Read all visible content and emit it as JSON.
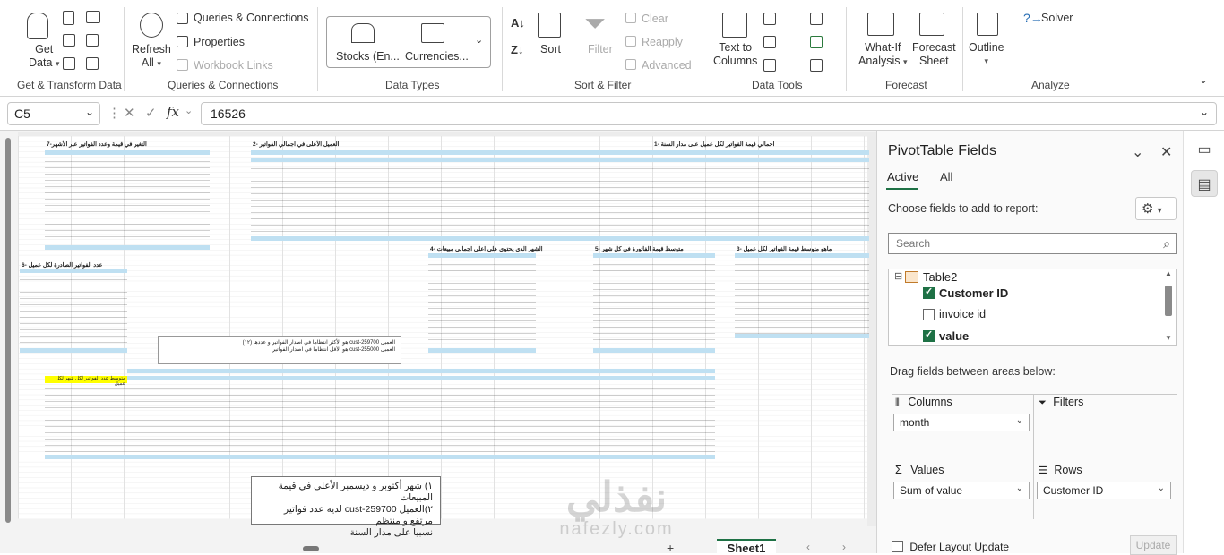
{
  "ribbon": {
    "get_data": "Get\nData",
    "get_data_l1": "Get",
    "get_data_l2": "Data",
    "queries_connections": "Queries & Connections",
    "properties": "Properties",
    "workbook_links": "Workbook Links",
    "refresh_l1": "Refresh",
    "refresh_l2": "All",
    "stocks": "Stocks (En...",
    "currencies": "Currencies...",
    "sort": "Sort",
    "filter": "Filter",
    "clear": "Clear",
    "reapply": "Reapply",
    "advanced": "Advanced",
    "text_to_columns_l1": "Text to",
    "text_to_columns_l2": "Columns",
    "what_if_l1": "What-If",
    "what_if_l2": "Analysis",
    "forecast_sheet_l1": "Forecast",
    "forecast_sheet_l2": "Sheet",
    "outline": "Outline",
    "solver": "Solver",
    "groups": {
      "get_transform": "Get & Transform Data",
      "queries": "Queries & Connections",
      "data_types": "Data Types",
      "sort_filter": "Sort & Filter",
      "data_tools": "Data Tools",
      "forecast": "Forecast",
      "analyze": "Analyze"
    }
  },
  "formula_bar": {
    "name_box": "C5",
    "value": "16526"
  },
  "sheet": {
    "tab": "Sheet1",
    "title_1": "اجمالي قيمة الفواتير لكل عميل على مدار السنة -1",
    "title_2": "العميل الأعلى في اجمالي الفواتير -2",
    "title_7": "التغير في قيمة وعدد الفواتير عبر الأشهر-7",
    "title_4": "الشهر الذي يحتوي على اعلى اجمالي مبيعات -4",
    "title_5": "متوسط قيمة الفاتورة في كل شهر -5",
    "title_3": "ماهو متوسط قيمة الفواتير لكل عميل -3",
    "title_6": "عدد الفواتير الصادرة لكل عميل -6",
    "yellow_note": "متوسط عدد الفواتير لكل شهر لكل عميل",
    "note_small_1": "العميل cust-259700 هو الأكثر انتظاما في اصدار الفواتير و عددها (١٢)",
    "note_small_2": "العميل cust-255000 هو الأقل انتظاما في اصدار الفواتير",
    "note_big_1": "١) شهر أكتوبر و ديسمبر الأعلى في قيمة المبيعات",
    "note_big_2": "٢)العميل cust-259700 لديه عدد فواتير مرتفع و منتظم",
    "note_big_3": "نسبيا على مدار السنة",
    "watermark_big": "نفذلي",
    "watermark_small": "nafezly.com"
  },
  "pivot": {
    "title": "PivotTable Fields",
    "tab_active": "Active",
    "tab_all": "All",
    "choose_label": "Choose fields to add to report:",
    "search_placeholder": "Search",
    "table_name": "Table2",
    "fields": [
      {
        "name": "Customer ID",
        "checked": true
      },
      {
        "name": "invoice id",
        "checked": false
      },
      {
        "name": "value",
        "checked": true
      }
    ],
    "drag_label": "Drag fields between areas below:",
    "areas": {
      "columns_label": "Columns",
      "filters_label": "Filters",
      "values_label": "Values",
      "rows_label": "Rows",
      "columns_value": "month",
      "values_value": "Sum of value",
      "rows_value": "Customer ID"
    },
    "defer_label": "Defer Layout Update",
    "update_label": "Update"
  },
  "colors": {
    "accent_green": "#1e7145",
    "pivot_header_blue": "#bfe0f2",
    "highlight_yellow": "#ffff00"
  }
}
